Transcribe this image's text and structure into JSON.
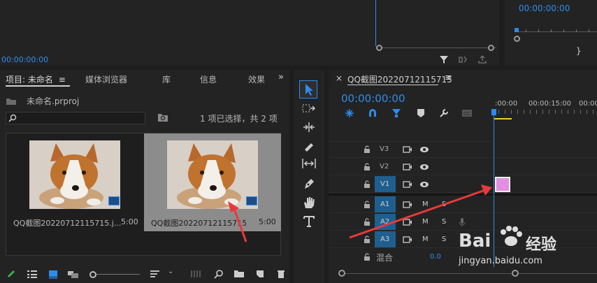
{
  "source_monitor": {
    "timecode": "00:00:00:00"
  },
  "program_monitor": {
    "timecode": "00:00:00:00",
    "bracket_label": "}"
  },
  "project_panel": {
    "tabs": [
      {
        "label": "项目: 未命名"
      },
      {
        "label": "媒体浏览器"
      },
      {
        "label": "库"
      },
      {
        "label": "信息"
      },
      {
        "label": "效果"
      }
    ],
    "project_file": "未命名.prproj",
    "search_placeholder": "",
    "selection_status": "1 项已选择，共 2 项",
    "items": [
      {
        "name": "QQ截图20220712115715.j...",
        "duration": "5:00",
        "selected": false
      },
      {
        "name": "QQ截图20220712115715",
        "duration": "5:00",
        "selected": true
      }
    ]
  },
  "timeline_panel": {
    "sequence_name": "QQ截图20220712115715",
    "timecode": "00:00:00:00",
    "ruler": [
      ":00:00",
      "00:00:15:00",
      "00:00"
    ],
    "video_tracks": [
      {
        "name": "V3",
        "target": false
      },
      {
        "name": "V2",
        "target": false
      },
      {
        "name": "V1",
        "target": true
      }
    ],
    "audio_tracks": [
      {
        "name": "A1",
        "m": "M",
        "s": "S"
      },
      {
        "name": "A2",
        "m": "M",
        "s": "S"
      },
      {
        "name": "A3",
        "m": "M",
        "s": "S"
      }
    ],
    "mix": {
      "label": "混合",
      "value": "0.0"
    }
  },
  "watermark": {
    "brand": "Bai",
    "brand2": "经验",
    "url": "jingyan.baidu.com"
  },
  "colors": {
    "accent": "#2d8ceb",
    "clip": "#e38ee0",
    "arrow": "#e8393b",
    "track_target": "#1f5f8f"
  }
}
